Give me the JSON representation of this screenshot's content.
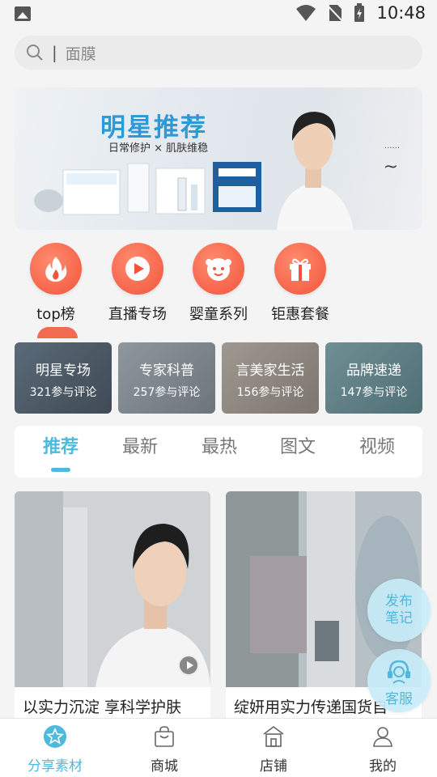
{
  "status_bar": {
    "time": "10:48"
  },
  "search": {
    "placeholder": "面膜"
  },
  "banner": {
    "title": "明星推荐",
    "subtitle": "日常修护 × 肌肤维稳"
  },
  "categories": [
    {
      "label": "top榜",
      "icon": "flame-icon"
    },
    {
      "label": "直播专场",
      "icon": "play-icon"
    },
    {
      "label": "婴童系列",
      "icon": "baby-icon"
    },
    {
      "label": "钜惠套餐",
      "icon": "gift-icon"
    }
  ],
  "topic_tiles": [
    {
      "name": "明星专场",
      "count": "321参与评论"
    },
    {
      "name": "专家科普",
      "count": "257参与评论"
    },
    {
      "name": "言美家生活",
      "count": "156参与评论"
    },
    {
      "name": "品牌速递",
      "count": "147参与评论"
    }
  ],
  "tabs": [
    "推荐",
    "最新",
    "最热",
    "图文",
    "视频"
  ],
  "active_tab": "推荐",
  "feed": [
    {
      "title": "以实力沉淀 享科学护肤",
      "has_video": true
    },
    {
      "title": "绽妍用实力传递国货自",
      "has_video": false
    }
  ],
  "fabs": {
    "publish": "发布\n笔记",
    "service": "客服"
  },
  "bottom_nav": [
    {
      "label": "分享素材",
      "icon": "star-icon",
      "active": true
    },
    {
      "label": "商城",
      "icon": "bag-icon",
      "active": false
    },
    {
      "label": "店铺",
      "icon": "store-icon",
      "active": false
    },
    {
      "label": "我的",
      "icon": "user-icon",
      "active": false
    }
  ],
  "colors": {
    "accent": "#4fb9dd",
    "category": "#f2553c"
  }
}
